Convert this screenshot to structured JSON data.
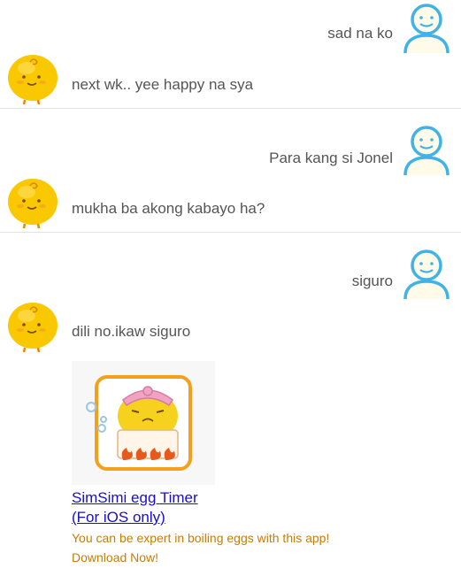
{
  "messages": [
    {
      "from": "user",
      "text": "sad na ko"
    },
    {
      "from": "bot",
      "text": "next wk.. yee happy na sya"
    },
    {
      "from": "user",
      "text": "Para kang si Jonel"
    },
    {
      "from": "bot",
      "text": "mukha ba akong kabayo ha?"
    },
    {
      "from": "user",
      "text": "siguro"
    },
    {
      "from": "bot",
      "text": "dili no.ikaw siguro"
    }
  ],
  "ad": {
    "title_line1": "SimSimi egg Timer",
    "title_line2": "(For iOS only)",
    "description": "You can be expert in boiling eggs with this app! Download Now!"
  },
  "colors": {
    "user_avatar": "#3fb3e8",
    "bot_avatar": "#f9c800",
    "link": "#1a0dcc",
    "ad_text": "#c67c0b"
  }
}
